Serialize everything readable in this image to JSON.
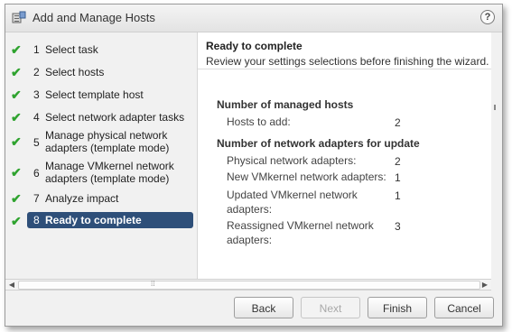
{
  "window": {
    "title": "Add and Manage Hosts",
    "help": "?"
  },
  "steps": [
    {
      "num": "1",
      "label": "Select task"
    },
    {
      "num": "2",
      "label": "Select hosts"
    },
    {
      "num": "3",
      "label": "Select template host"
    },
    {
      "num": "4",
      "label": "Select network adapter tasks"
    },
    {
      "num": "5",
      "label_line1": "Manage physical network",
      "label_line2": "adapters (template mode)"
    },
    {
      "num": "6",
      "label_line1": "Manage VMkernel network",
      "label_line2": "adapters (template mode)"
    },
    {
      "num": "7",
      "label": "Analyze impact"
    },
    {
      "num": "8",
      "label": "Ready to complete"
    }
  ],
  "content": {
    "title": "Ready to complete",
    "subtitle": "Review your settings selections before finishing the wizard.",
    "section1": {
      "heading": "Number of managed hosts",
      "rows": [
        {
          "label": "Hosts to add:",
          "value": "2"
        }
      ]
    },
    "section2": {
      "heading": "Number of network adapters for update",
      "rows": [
        {
          "label": "Physical network adapters:",
          "value": "2"
        },
        {
          "label": "New VMkernel network adapters:",
          "value": "1"
        },
        {
          "label_line1": "Updated VMkernel network",
          "label_line2": "adapters:",
          "value": "1"
        },
        {
          "label_line1": "Reassigned VMkernel network",
          "label_line2": "adapters:",
          "value": "3"
        }
      ]
    }
  },
  "buttons": {
    "back": "Back",
    "next": "Next",
    "finish": "Finish",
    "cancel": "Cancel"
  },
  "colors": {
    "active_step": "#2e4f79",
    "check": "#2fa32f"
  }
}
